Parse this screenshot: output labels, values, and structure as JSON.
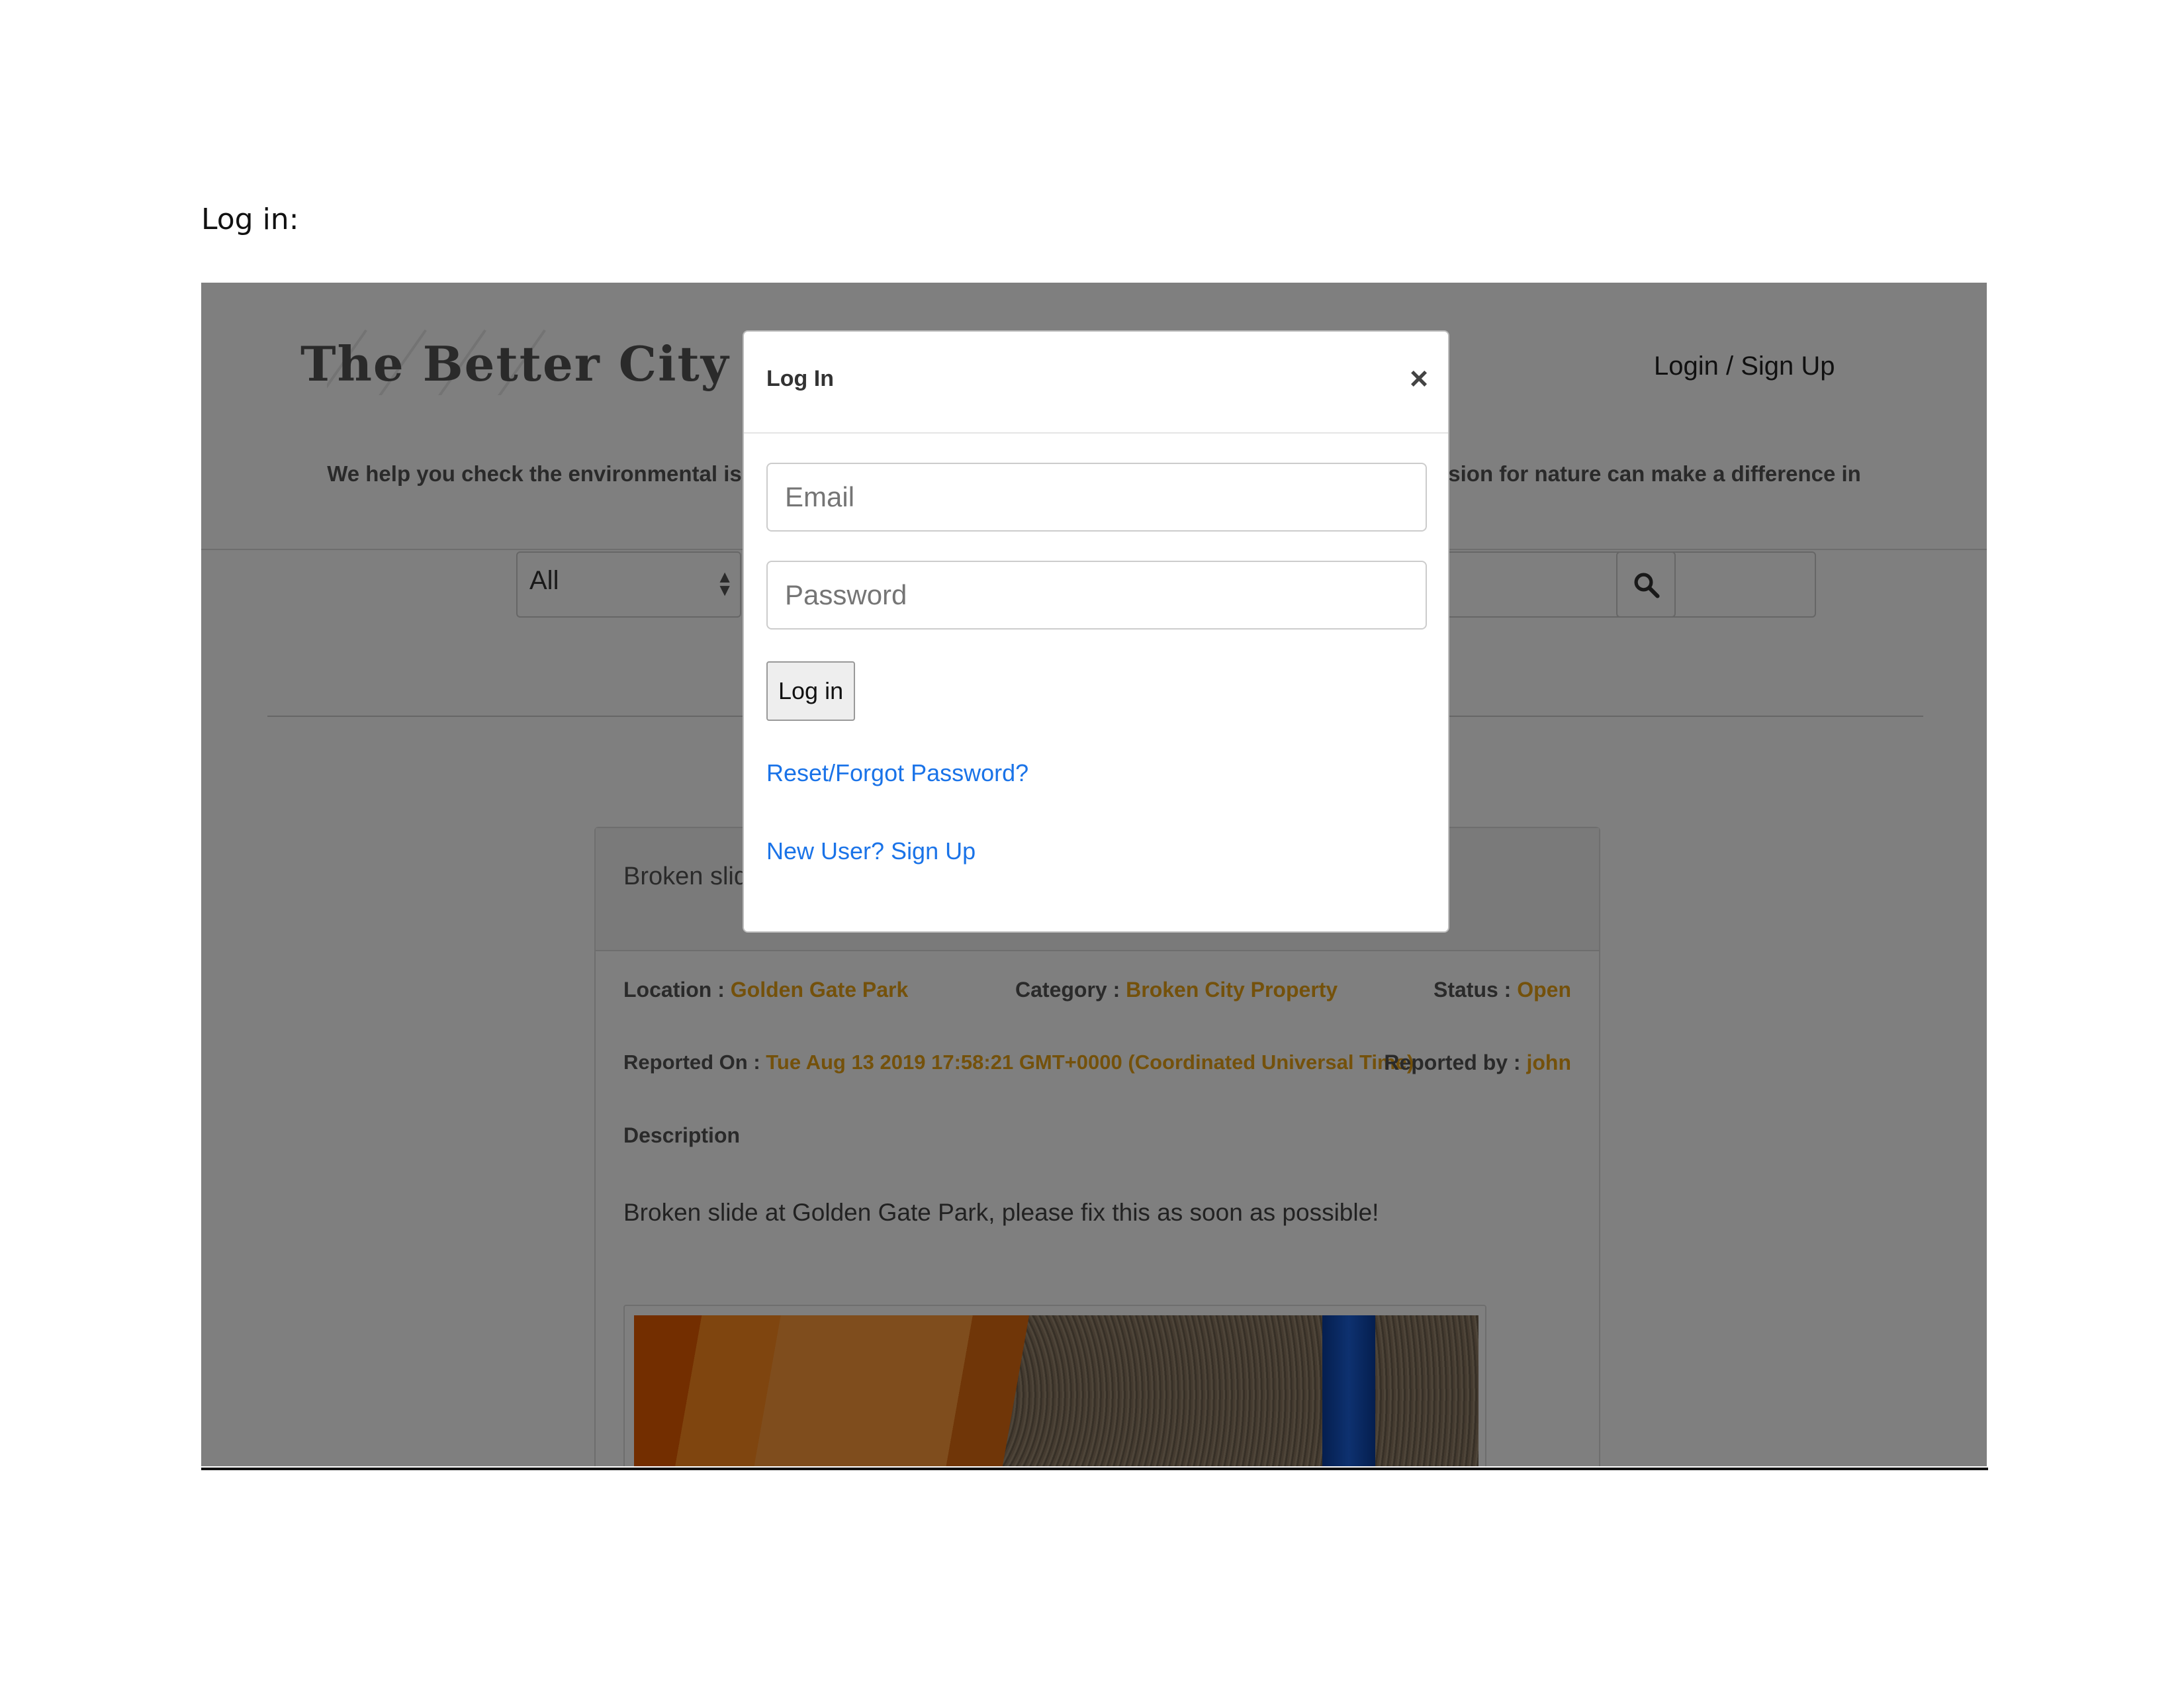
{
  "doc": {
    "label": "Log in:"
  },
  "site": {
    "brand": "The Better City",
    "login_link": "Login / Sign Up",
    "tagline_left": "We help you check the environmental iss",
    "tagline_right": "ision for nature can make a difference in",
    "filter": {
      "selected": "All"
    }
  },
  "post": {
    "title_partial": "Broken slide",
    "location_label": "Location :",
    "location_value": "Golden Gate Park",
    "category_label": "Category :",
    "category_value": "Broken City Property",
    "status_label": "Status :",
    "status_value": "Open",
    "reported_on_label": "Reported On :",
    "reported_on_value": "Tue Aug 13 2019 17:58:21 GMT+0000 (Coordinated Universal Time)",
    "reported_by_label": "Reported by :",
    "reported_by_value": "john",
    "description_label": "Description",
    "description": "Broken slide at Golden Gate Park, please fix this as soon as possible!"
  },
  "modal": {
    "title": "Log In",
    "close": "×",
    "email_placeholder": "Email",
    "password_placeholder": "Password",
    "login_button": "Log in",
    "forgot_link": "Reset/Forgot Password?",
    "signup_link": "New User? Sign Up"
  },
  "colors": {
    "accent": "#e8a317",
    "link": "#1a73e8",
    "overlay": "rgba(0,0,0,0.5)"
  }
}
